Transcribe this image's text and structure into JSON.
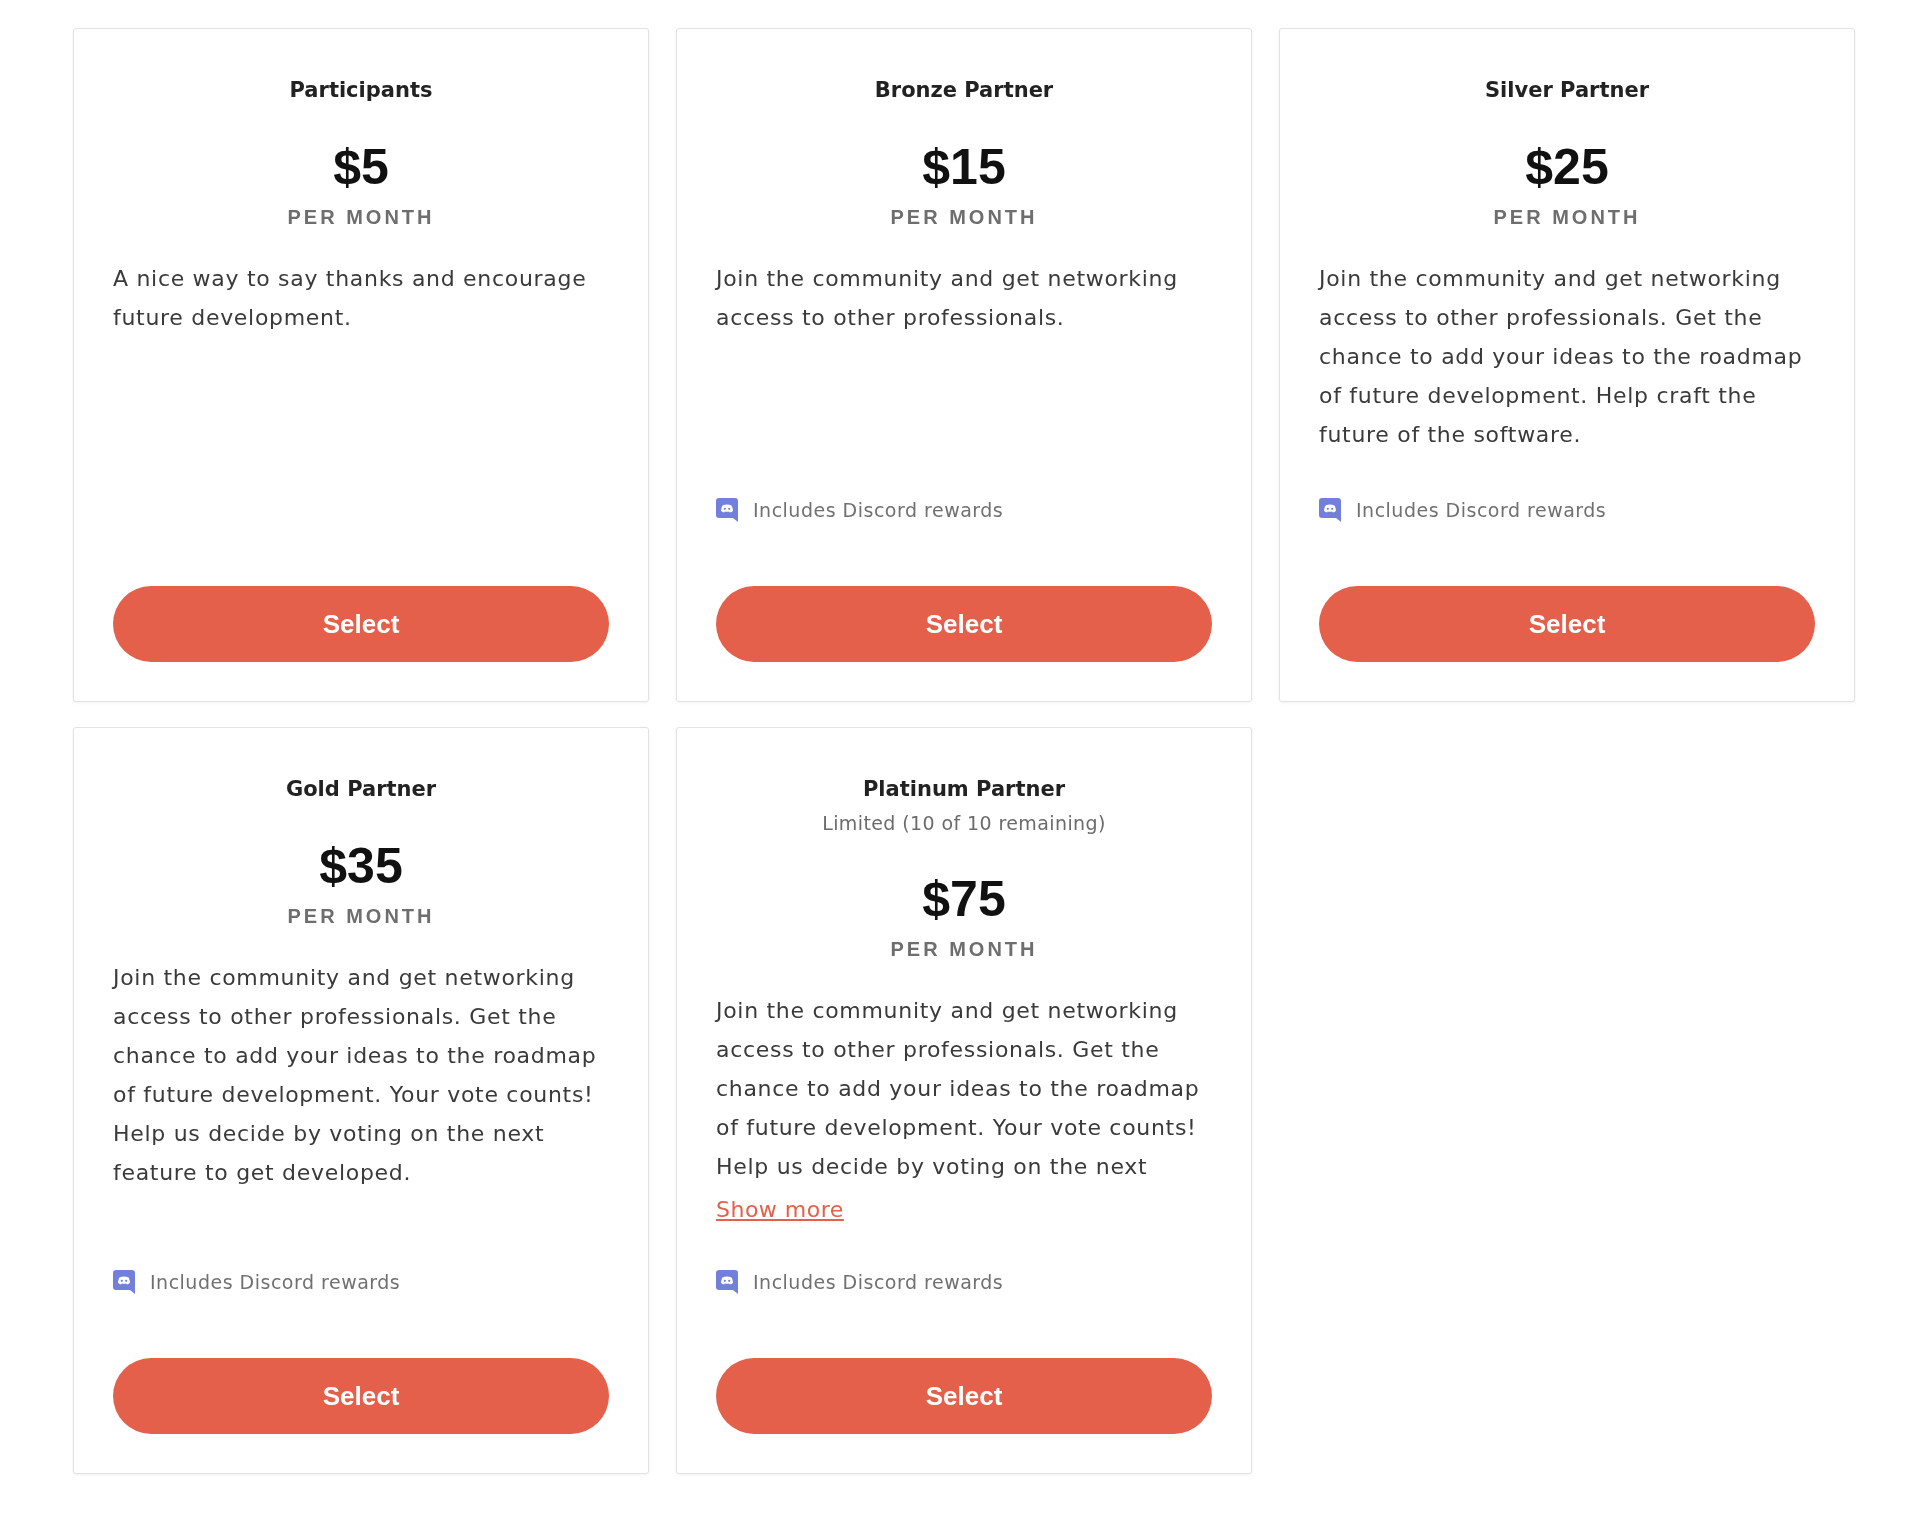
{
  "tiers": [
    {
      "name": "Participants",
      "price": "$5",
      "period": "PER MONTH",
      "description": "A nice way to say thanks and encourage future development.",
      "button": "Select"
    },
    {
      "name": "Bronze Partner",
      "price": "$15",
      "period": "PER MONTH",
      "description": "Join the community and get networking access to other professionals.",
      "perk": "Includes Discord rewards",
      "button": "Select"
    },
    {
      "name": "Silver Partner",
      "price": "$25",
      "period": "PER MONTH",
      "description": "Join the community and get networking access to other professionals. Get the chance to add your ideas to the roadmap of future development. Help craft the future of the software.",
      "perk": "Includes Discord rewards",
      "button": "Select"
    },
    {
      "name": "Gold Partner",
      "price": "$35",
      "period": "PER MONTH",
      "description": "Join the community and get networking access to other professionals. Get the chance to add your ideas to the roadmap of future development. Your vote counts! Help us decide by voting on the next feature to get developed.",
      "perk": "Includes Discord rewards",
      "button": "Select"
    },
    {
      "name": "Platinum Partner",
      "availability": "Limited (10 of 10 remaining)",
      "price": "$75",
      "period": "PER MONTH",
      "description": "Join the community and get networking access to other professionals. Get the chance to add your ideas to the roadmap of future development. Your vote counts! Help us decide by voting on the next",
      "show_more": "Show more",
      "perk": "Includes Discord rewards",
      "button": "Select"
    }
  ]
}
